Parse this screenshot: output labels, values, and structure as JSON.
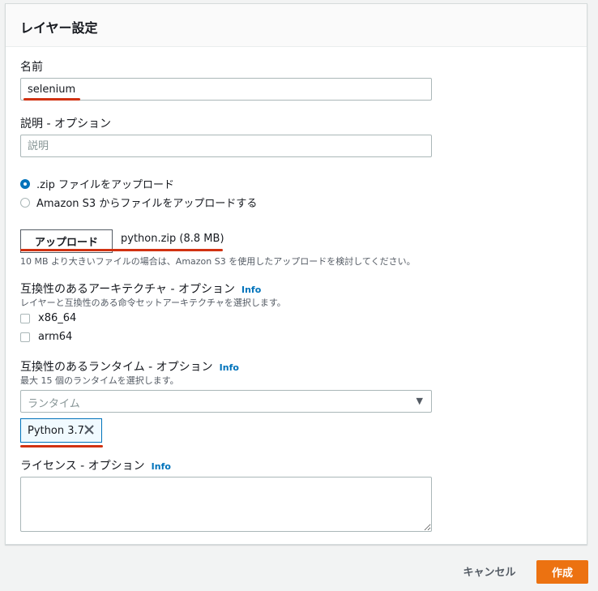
{
  "panel": {
    "title": "レイヤー設定"
  },
  "name_field": {
    "label": "名前",
    "value": "selenium"
  },
  "description_field": {
    "label": "説明 - オプション",
    "placeholder": "説明"
  },
  "upload_source": {
    "options": [
      {
        "label": ".zip ファイルをアップロード",
        "selected": true
      },
      {
        "label": "Amazon S3 からファイルをアップロードする",
        "selected": false
      }
    ]
  },
  "upload": {
    "button_label": "アップロード",
    "file_name": "python.zip (8.8 MB)",
    "hint": "10 MB より大きいファイルの場合は、Amazon S3 を使用したアップロードを検討してください。"
  },
  "architectures": {
    "label": "互換性のあるアーキテクチャ - オプション",
    "info": "Info",
    "hint": "レイヤーと互換性のある命令セットアーキテクチャを選択します。",
    "options": [
      {
        "label": "x86_64",
        "checked": false
      },
      {
        "label": "arm64",
        "checked": false
      }
    ]
  },
  "runtimes": {
    "label": "互換性のあるランタイム - オプション",
    "info": "Info",
    "hint": "最大 15 個のランタイムを選択します。",
    "placeholder": "ランタイム",
    "selected_tokens": [
      "Python 3.7"
    ]
  },
  "license": {
    "label": "ライセンス - オプション",
    "info": "Info"
  },
  "footer": {
    "cancel_label": "キャンセル",
    "create_label": "作成"
  },
  "colors": {
    "accent": "#0073bb",
    "primary_button": "#ec7211",
    "annotation": "#d13212"
  }
}
